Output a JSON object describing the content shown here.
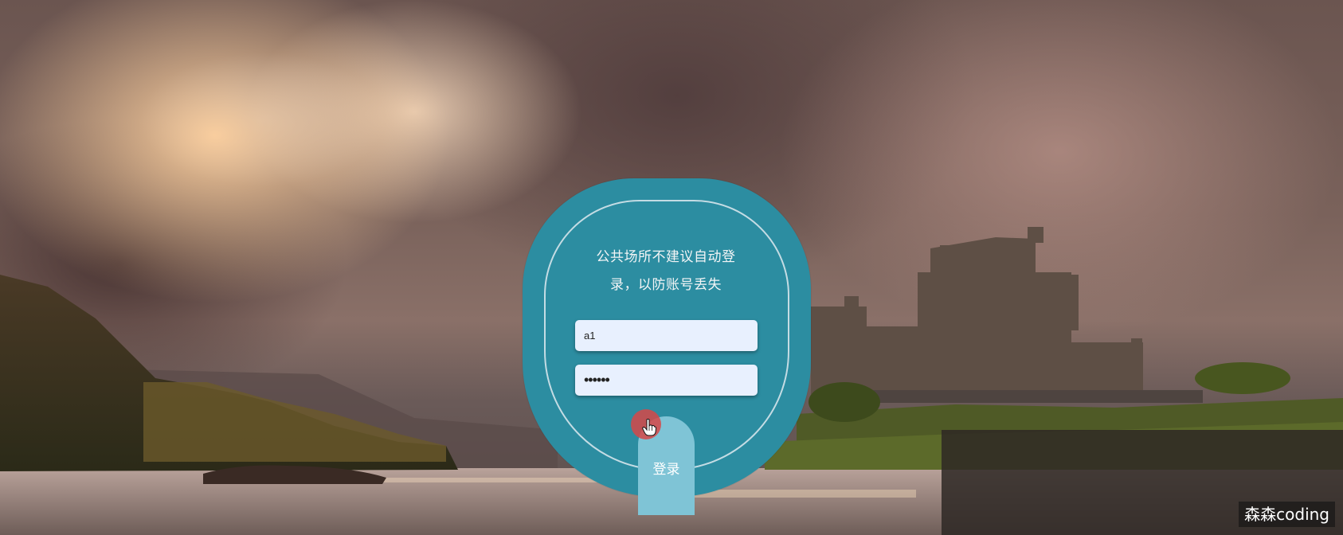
{
  "login": {
    "hint": "公共场所不建议自动登录，以防账号丢失",
    "username_value": "a1",
    "password_mask": "••••••",
    "submit_label": "登录"
  },
  "watermark": "森森coding",
  "colors": {
    "card": "#2c8da1",
    "button": "#7fc4d6",
    "input_bg": "#e8f0fe",
    "cursor_highlight": "#d64848"
  },
  "icons": [
    "hand-pointer-icon"
  ]
}
